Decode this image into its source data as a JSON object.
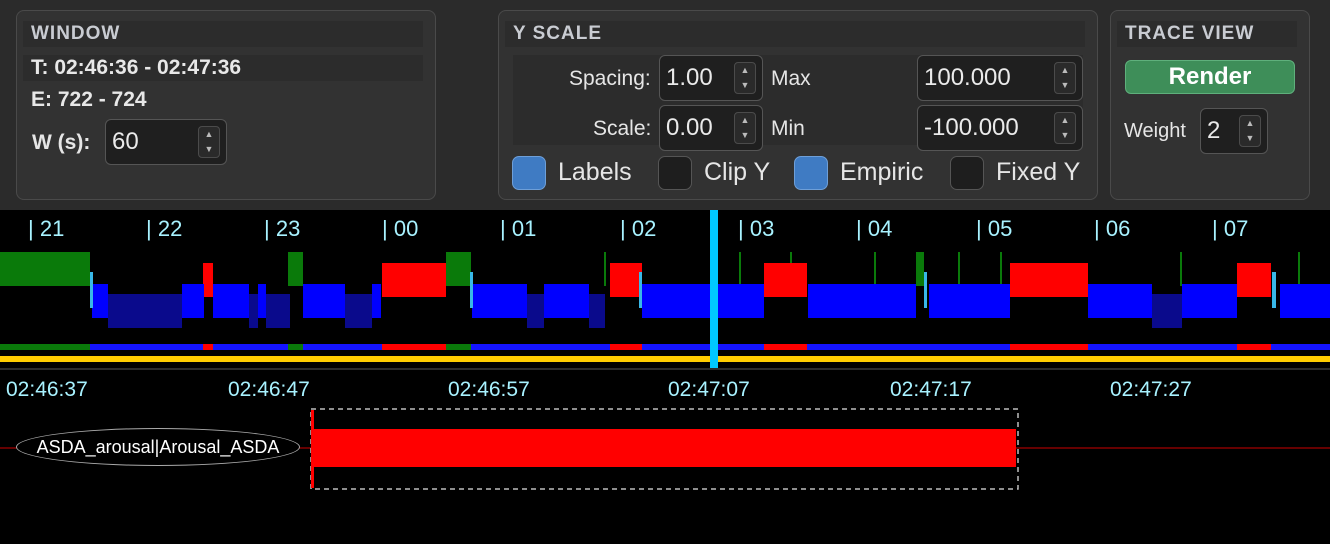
{
  "window_panel": {
    "title": "WINDOW",
    "time_range": "T: 02:46:36 - 02:47:36",
    "epoch_range": "E: 722 - 724",
    "width_label": "W (s):",
    "width_value": "60"
  },
  "y_scale_panel": {
    "title": "Y SCALE",
    "spacing_label": "Spacing:",
    "spacing_value": "1.00",
    "scale_label": "Scale:",
    "scale_value": "0.00",
    "max_label": "Max",
    "max_value": "100.000",
    "min_label": "Min",
    "min_value": "-100.000",
    "checkboxes": [
      {
        "label": "Labels",
        "checked": true
      },
      {
        "label": "Clip Y",
        "checked": false
      },
      {
        "label": "Empiric",
        "checked": true
      },
      {
        "label": "Fixed Y",
        "checked": false
      }
    ]
  },
  "trace_view_panel": {
    "title": "TRACE VIEW",
    "render_label": "Render",
    "weight_label": "Weight",
    "weight_value": "2"
  },
  "overview": {
    "hour_ticks": [
      "| 21",
      "| 22",
      "| 23",
      "| 00",
      "| 01",
      "| 02",
      "| 03",
      "| 04",
      "| 05",
      "| 06",
      "| 07"
    ],
    "colors": {
      "wake": "#00ff00",
      "rem": "#ff0000",
      "nrem": "#0000ff",
      "cursor": "#00c8ff",
      "timeline": "#ffcc00"
    }
  },
  "detail": {
    "time_labels": [
      "02:46:37",
      "02:46:47",
      "02:46:57",
      "02:47:07",
      "02:47:17",
      "02:47:27"
    ],
    "trace_label": "ASDA_arousal|Arousal_ASDA",
    "event_color": "#ff0000"
  }
}
